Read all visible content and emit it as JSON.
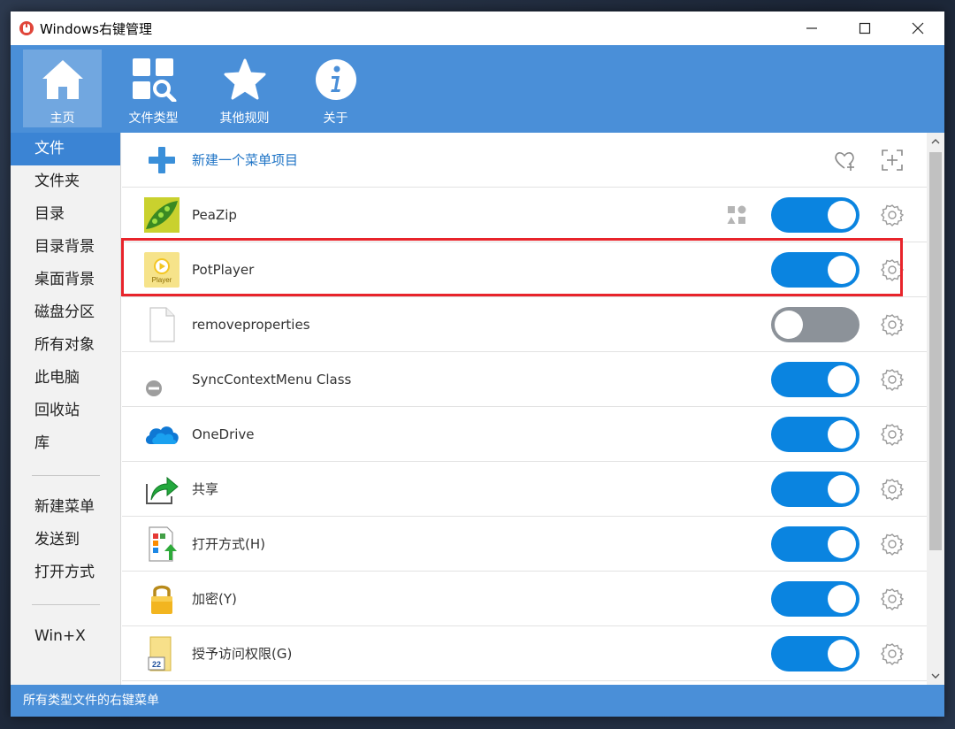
{
  "window": {
    "title": "Windows右键管理"
  },
  "toolbar": {
    "items": [
      {
        "label": "主页",
        "icon": "home-icon",
        "active": true
      },
      {
        "label": "文件类型",
        "icon": "file-type-search-icon",
        "active": false
      },
      {
        "label": "其他规则",
        "icon": "star-icon",
        "active": false
      },
      {
        "label": "关于",
        "icon": "info-icon",
        "active": false
      }
    ]
  },
  "sidebar": {
    "group1": [
      "文件",
      "文件夹",
      "目录",
      "目录背景",
      "桌面背景",
      "磁盘分区",
      "所有对象",
      "此电脑",
      "回收站",
      "库"
    ],
    "group2": [
      "新建菜单",
      "发送到",
      "打开方式"
    ],
    "group3": [
      "Win+X"
    ],
    "active": "文件"
  },
  "list": {
    "new_item_label": "新建一个菜单项目",
    "items": [
      {
        "label": "PeaZip",
        "icon": "peazip-icon",
        "enabled": true
      },
      {
        "label": "PotPlayer",
        "icon": "potplayer-icon",
        "icon_text": "Player",
        "enabled": true
      },
      {
        "label": "removeproperties",
        "icon": "blank-file-icon",
        "enabled": false
      },
      {
        "label": "SyncContextMenu Class",
        "icon": "minus-circle-icon",
        "enabled": true
      },
      {
        "label": "OneDrive",
        "icon": "onedrive-cloud-icon",
        "enabled": true
      },
      {
        "label": "共享",
        "icon": "share-arrow-icon",
        "enabled": true
      },
      {
        "label": "打开方式(H)",
        "icon": "open-with-icon",
        "enabled": true
      },
      {
        "label": "加密(Y)",
        "icon": "lock-icon",
        "enabled": true
      },
      {
        "label": "授予访问权限(G)",
        "icon": "grant-access-icon",
        "icon_text": "22",
        "enabled": true
      }
    ]
  },
  "statusbar": {
    "text": "所有类型文件的右键菜单"
  },
  "colors": {
    "accent": "#4a8fd8",
    "sidebar_active": "#3b84d4",
    "toggle_on": "#0a84e0",
    "toggle_off": "#8c9299",
    "highlight": "#e8242b"
  }
}
